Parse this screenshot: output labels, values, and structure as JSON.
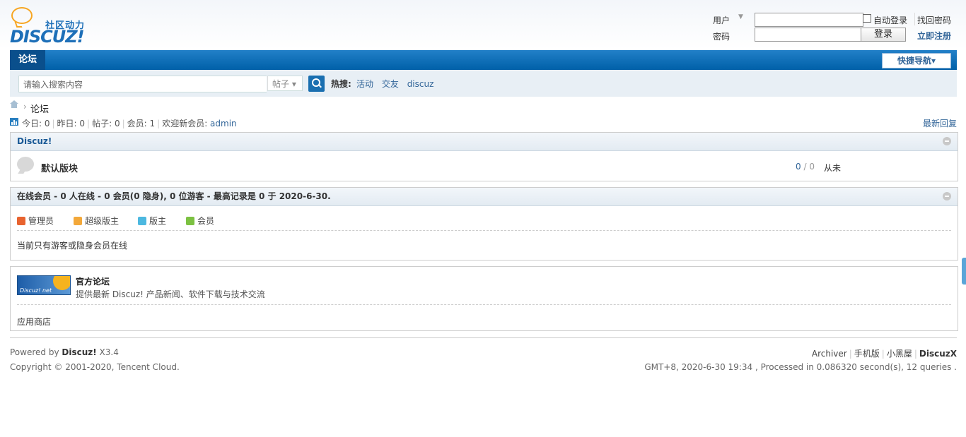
{
  "header": {
    "logo_slogan": "社区动力",
    "logo_word": "DISCUZ!",
    "login": {
      "user_label": "用户",
      "password_label": "密码",
      "auto_login": "自动登录",
      "find_password": "找回密码",
      "login_button": "登录",
      "register": "立即注册"
    }
  },
  "nav": {
    "tab": "论坛",
    "quick_nav": "快捷导航▾"
  },
  "search": {
    "placeholder": "请输入搜索内容",
    "type": "帖子 ▾",
    "hot_label": "热搜:",
    "hot_links": [
      "活动",
      "交友",
      "discuz"
    ]
  },
  "breadcrumb": {
    "separator": "›",
    "current": "论坛"
  },
  "stats": {
    "today": "今日: 0",
    "yesterday": "昨日: 0",
    "posts": "帖子: 0",
    "members": "会员: 1",
    "welcome_label": "欢迎新会员: ",
    "new_member": "admin",
    "latest_reply": "最新回复"
  },
  "category": {
    "title": "Discuz!",
    "forum": {
      "name": "默认版块",
      "threads": "0",
      "slash": " / ",
      "posts": "0",
      "last_post": "从未"
    }
  },
  "online": {
    "title": "在线会员 - 0 人在线 - 0 会员(0 隐身), 0 位游客 - 最高记录是 0 于 2020-6-30.",
    "legend": [
      {
        "label": "管理员",
        "color": "#e8632f"
      },
      {
        "label": "超级版主",
        "color": "#f3a83a"
      },
      {
        "label": "版主",
        "color": "#4cb8e0"
      },
      {
        "label": "会员",
        "color": "#7cc142"
      }
    ],
    "message": "当前只有游客或隐身会员在线"
  },
  "links": {
    "banner_text": "Discuz! net",
    "title": "官方论坛",
    "desc": "提供最新 Discuz! 产品新闻、软件下载与技术交流",
    "app": "应用商店"
  },
  "footer": {
    "powered_prefix": "Powered by ",
    "powered_name": "Discuz!",
    "powered_version": " X3.4",
    "copyright": "Copyright © 2001-2020, Tencent Cloud.",
    "links": [
      "Archiver",
      "手机版",
      "小黑屋",
      "DiscuzX"
    ],
    "processed": "GMT+8, 2020-6-30 19:34 , Processed in 0.086320 second(s), 12 queries ."
  }
}
